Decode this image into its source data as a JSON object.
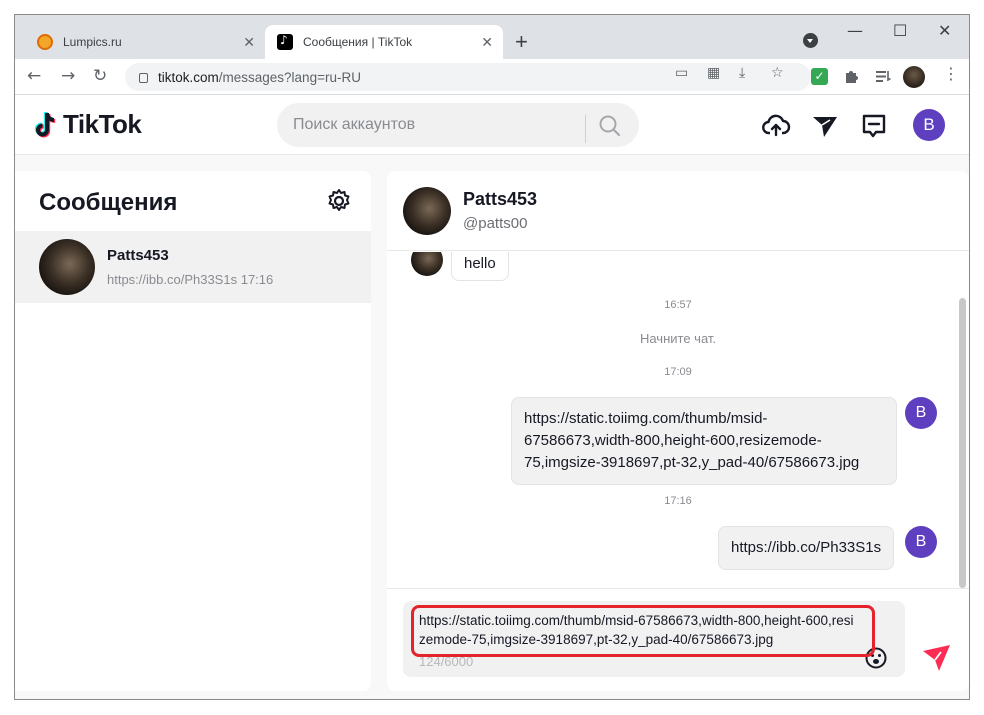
{
  "browser": {
    "tabs": [
      {
        "title": "Lumpics.ru",
        "active": false
      },
      {
        "title": "Сообщения | TikTok",
        "active": true
      }
    ],
    "new_tab": "+",
    "window_controls": {
      "minimize": "—",
      "maximize": "☐",
      "close": "✕"
    },
    "nav": {
      "back": "←",
      "forward": "→",
      "reload": "↻"
    },
    "address": {
      "host": "tiktok.com",
      "path": "/messages?lang=ru-RU"
    }
  },
  "tiktok": {
    "logo_text": "TikTok",
    "search": {
      "placeholder": "Поиск аккаунтов"
    },
    "header_icons": [
      "upload-icon",
      "send-inbox-icon",
      "messages-icon"
    ],
    "profile_initial": "B"
  },
  "messages_panel": {
    "title": "Сообщения",
    "conversations": [
      {
        "name": "Patts453",
        "preview": "https://ibb.co/Ph33S1s",
        "time": "17:16"
      }
    ]
  },
  "chat": {
    "nickname": "Patts453",
    "handle": "@patts00",
    "items": [
      {
        "kind": "incoming",
        "text": "hello"
      },
      {
        "kind": "time",
        "text": "16:57"
      },
      {
        "kind": "system",
        "text": "Начните чат."
      },
      {
        "kind": "time",
        "text": "17:09"
      },
      {
        "kind": "outgoing",
        "text": "https://static.toiimg.com/thumb/msid-67586673,width-800,height-600,resizemode-75,imgsize-3918697,pt-32,y_pad-40/67586673.jpg",
        "lines": [
          "https://static.toiimg.com/thumb/msid-",
          "67586673,width-800,height-600,resizemode-",
          "75,imgsize-3918697,pt-32,y_pad-40/67586673.jpg"
        ]
      },
      {
        "kind": "time",
        "text": "17:16"
      },
      {
        "kind": "outgoing",
        "text": "https://ibb.co/Ph33S1s"
      }
    ],
    "my_initial": "B",
    "composer": {
      "value": "https://static.toiimg.com/thumb/msid-67586673,width-800,height-600,resizemode-75,imgsize-3918697,pt-32,y_pad-40/67586673.jpg",
      "counter": "124/6000"
    }
  },
  "colors": {
    "accent": "#fe2c55",
    "avatar": "#5d3fbf",
    "highlight": "#e5232a"
  }
}
